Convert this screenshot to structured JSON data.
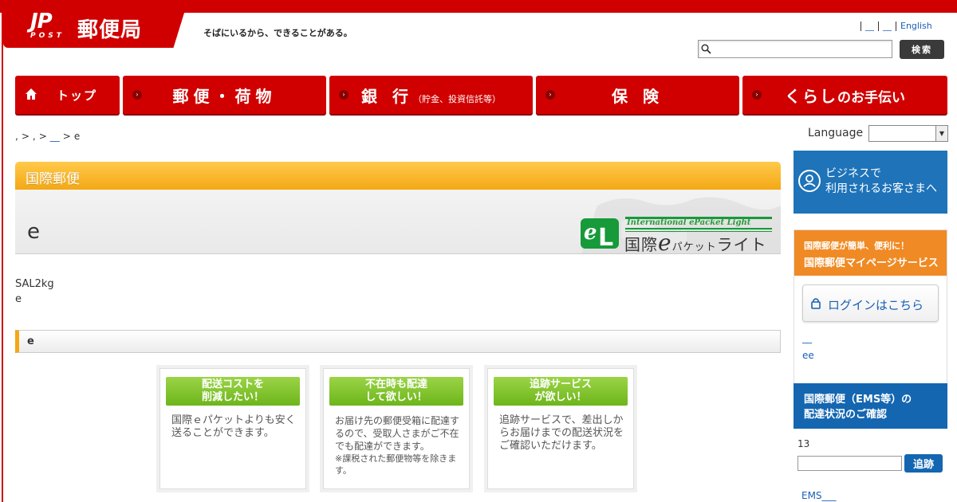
{
  "header": {
    "logo_mark": "JP",
    "logo_post": "POST",
    "logo_name": "郵便局",
    "tagline": "そばにいるから、できることがある。",
    "util_links": [
      "__",
      "__",
      "English"
    ]
  },
  "search": {
    "button": "検索"
  },
  "gnav": {
    "home": "トップ",
    "postal": "郵便・荷物",
    "bank": "銀 行",
    "bank_sub": "（貯金、投資信託等）",
    "insurance": "保 険",
    "life": "くらし",
    "life_sub": "のお手伝い"
  },
  "breadcrumb": {
    "p1": ",",
    "sep1": ">",
    "p2": ",",
    "sep2": ">",
    "p3": "__",
    "sep3": ">",
    "current": "e"
  },
  "language": {
    "label": "Language"
  },
  "main": {
    "section_title": "国際郵便",
    "hero_title": "e",
    "service_logo_en": "International ePacket Light",
    "service_logo_jp_prefix": "国際",
    "service_logo_jp_e": "e",
    "service_logo_jp_small": "パケット",
    "service_logo_jp_suffix": "ライト",
    "intro_line1": "SAL2kg",
    "intro_line2": "e",
    "sub_title": "e",
    "cards": [
      {
        "head1": "配送コストを",
        "head2": "削減したい！",
        "body": "国際ｅパケットよりも安く送ることができます。",
        "note": ""
      },
      {
        "head1": "不在時も配達",
        "head2": "して欲しい！",
        "body": "お届け先の郵便受箱に配達するので、受取人さまがご不在でも配達ができます。",
        "note": "※課税された郵便物等を除きます。"
      },
      {
        "head1": "追跡サービス",
        "head2": "が欲しい！",
        "body": "追跡サービスで、差出しからお届けまでの配送状況をご確認いただけます。",
        "note": ""
      }
    ]
  },
  "sidebar": {
    "business_line1": "ビジネスで",
    "business_line2": "利用されるお客さまへ",
    "mypage_t1": "国際郵便が簡単、便利に！",
    "mypage_t2": "国際郵便マイページサービス",
    "login": "ログインはこちら",
    "link1": "__",
    "link2": "ee",
    "track_title1": "国際郵便（EMS等）の",
    "track_title2": "配達状況のご確認",
    "track_count": "13",
    "track_button": "追跡",
    "ems_link": "EMS___"
  },
  "colors": {
    "brand_red": "#d10000",
    "orange": "#f4a816",
    "blue": "#1466b1",
    "green": "#6db51b"
  }
}
